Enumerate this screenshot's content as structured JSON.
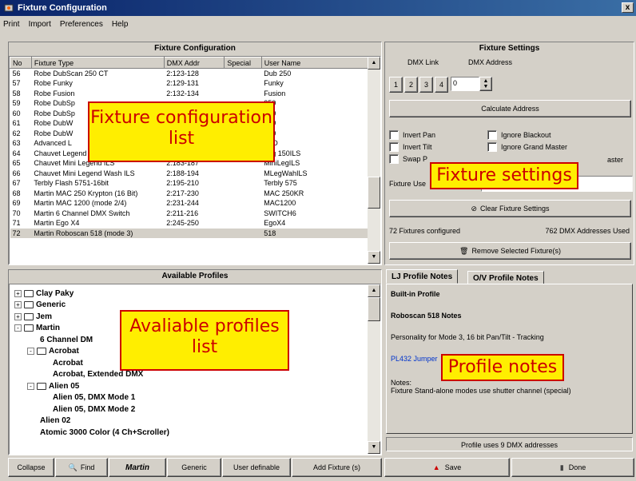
{
  "window": {
    "title": "Fixture Configuration",
    "close": "x"
  },
  "menu": [
    "Print",
    "Import",
    "Preferences",
    "Help"
  ],
  "fixture_config": {
    "title": "Fixture Configuration",
    "columns": [
      "No",
      "Fixture Type",
      "DMX Addr",
      "Special",
      "User Name"
    ],
    "rows": [
      [
        "56",
        "Robe DubScan 250 CT",
        "2:123-128",
        "",
        "Dub 250"
      ],
      [
        "57",
        "Robe Funky",
        "2:129-131",
        "",
        "Funky"
      ],
      [
        "58",
        "Robe Fusion",
        "2:132-134",
        "",
        "Fusion"
      ],
      [
        "59",
        "Robe DubSp",
        "",
        "",
        "250"
      ],
      [
        "60",
        "Robe DubSp",
        "",
        "",
        "250"
      ],
      [
        "61",
        "Robe DubW",
        "",
        "",
        "250"
      ],
      [
        "62",
        "Robe DubW",
        "",
        "",
        "250"
      ],
      [
        "63",
        "Advanced L",
        "",
        "",
        "LED"
      ],
      [
        "64",
        "Chauvet Legend 150DMR ILS",
        "2:176-182",
        "",
        "Leg 150ILS"
      ],
      [
        "65",
        "Chauvet Mini Legend ILS",
        "2:183-187",
        "",
        "MiniLegILS"
      ],
      [
        "66",
        "Chauvet Mini Legend Wash ILS",
        "2:188-194",
        "",
        "MLegWahILS"
      ],
      [
        "67",
        "Terbly Flash 5751-16bit",
        "2:195-210",
        "",
        "Terbly 575"
      ],
      [
        "68",
        "Martin MAC 250 Krypton (16 Bit)",
        "2:217-230",
        "",
        "MAC 250KR"
      ],
      [
        "69",
        "Martin MAC 1200 (mode 2/4)",
        "2:231-244",
        "",
        "MAC1200"
      ],
      [
        "70",
        "Martin 6 Channel DMX Switch",
        "2:211-216",
        "",
        "SWITCH6"
      ],
      [
        "71",
        "Martin Ego X4",
        "2:245-250",
        "",
        "EgoX4"
      ],
      [
        "72",
        "Martin Roboscan 518 (mode 3)",
        "",
        "",
        "518"
      ]
    ]
  },
  "fixture_settings": {
    "title": "Fixture Settings",
    "dmx_link_label": "DMX Link",
    "dmx_address_label": "DMX Address",
    "links": [
      "1",
      "2",
      "3",
      "4"
    ],
    "address_value": "0",
    "calculate": "Calculate Address",
    "checks": [
      "Invert Pan",
      "Invert Tilt",
      "Swap P",
      "Ignore Blackout",
      "Ignore Grand Master",
      "aster"
    ],
    "fixture_user_label": "Fixture Use",
    "clear": "Clear Fixture Settings",
    "configured": "72 Fixtures configured",
    "dmx_used": "762 DMX Addresses Used",
    "remove": "Remove Selected Fixture(s)"
  },
  "profiles": {
    "title": "Available Profiles",
    "tree": [
      {
        "label": "Clay Paky",
        "level": 0,
        "type": "folder",
        "exp": "+"
      },
      {
        "label": "Generic",
        "level": 0,
        "type": "folder",
        "exp": "+"
      },
      {
        "label": "Jem",
        "level": 0,
        "type": "folder",
        "exp": "+"
      },
      {
        "label": "Martin",
        "level": 0,
        "type": "folder",
        "exp": "-"
      },
      {
        "label": "6 Channel DM",
        "level": 2,
        "type": "leaf"
      },
      {
        "label": "Acrobat",
        "level": 1,
        "type": "folder",
        "exp": "-"
      },
      {
        "label": "Acrobat",
        "level": 3,
        "type": "leaf"
      },
      {
        "label": "Acrobat, Extended DMX",
        "level": 3,
        "type": "leaf"
      },
      {
        "label": "Alien 05",
        "level": 1,
        "type": "folder",
        "exp": "-"
      },
      {
        "label": "Alien 05, DMX Mode 1",
        "level": 3,
        "type": "leaf"
      },
      {
        "label": "Alien 05, DMX Mode 2",
        "level": 3,
        "type": "leaf"
      },
      {
        "label": "Alien 02",
        "level": 2,
        "type": "leaf"
      },
      {
        "label": "Atomic 3000 Color (4 Ch+Scroller)",
        "level": 2,
        "type": "leaf"
      }
    ]
  },
  "notes": {
    "tabs": [
      "LJ Profile Notes",
      "O/V Profile Notes"
    ],
    "builtin": "Built-in Profile",
    "heading": "Roboscan 518 Notes",
    "personality": "Personality for Mode 3, 16 bit Pan/Tilt - Tracking",
    "link": "PL432 Jumper",
    "notes_label": "Notes:",
    "notes_text": "Fixture Stand-alone modes use shutter channel (special)",
    "uses": "Profile uses 9 DMX addresses"
  },
  "bottom": {
    "collapse": "Collapse",
    "find": "Find",
    "martin": "Martin",
    "generic": "Generic",
    "user_definable": "User definable",
    "add": "Add Fixture (s)",
    "save": "Save",
    "done": "Done"
  },
  "callouts": {
    "fixture_list": "Fixture configuration list",
    "settings": "Fixture settings",
    "profiles": "Avaliable profiles list",
    "notes": "Profile notes"
  }
}
